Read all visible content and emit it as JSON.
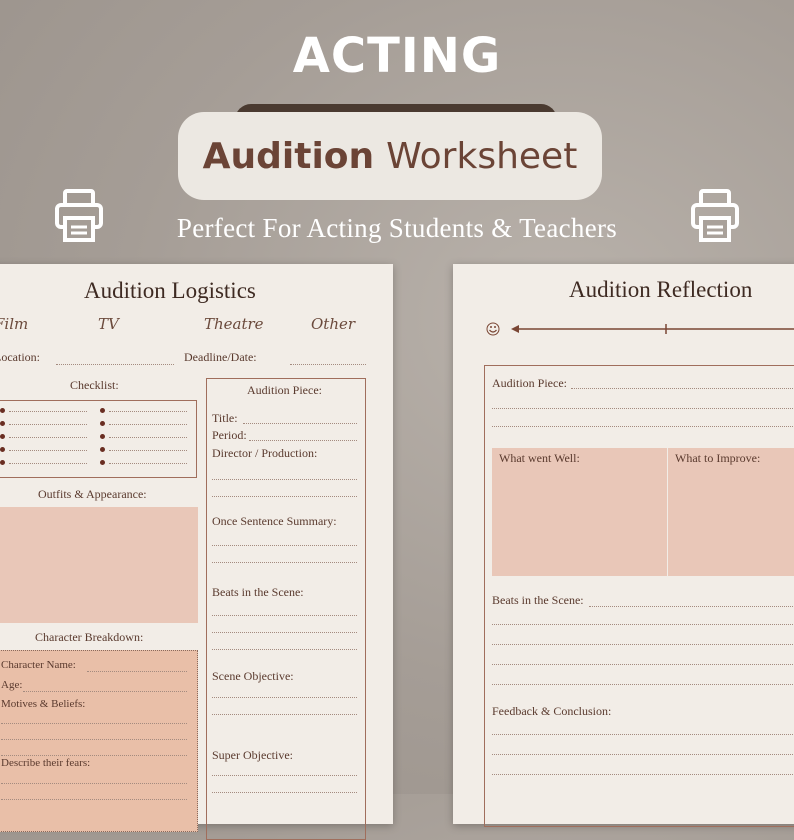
{
  "header": {
    "title": "ACTING",
    "badge_bold": "Audition",
    "badge_rest": "Worksheet",
    "subtitle": "Perfect For Acting Students & Teachers"
  },
  "colors": {
    "background": "#a59d96",
    "paper": "#f2ede7",
    "accent": "#a06e5c",
    "pink_fill": "#e9c7b8",
    "peach_fill": "#e9bfa8",
    "text": "#5a3a2e"
  },
  "icons": {
    "left_printer": "printer-icon",
    "right_printer": "printer-icon"
  },
  "logistics": {
    "title": "Audition Logistics",
    "media_types": [
      "Film",
      "TV",
      "Theatre",
      "Other"
    ],
    "location_label": "Location:",
    "deadline_label": "Deadline/Date:",
    "checklist_label": "Checklist:",
    "audition_piece": {
      "title": "Audition Piece:",
      "fields": [
        "Title:",
        "Period:",
        "Director / Production:"
      ],
      "summary": "Once Sentence Summary:",
      "beats": "Beats in the Scene:",
      "scene_objective": "Scene Objective:",
      "super_objective": "Super Objective:"
    },
    "outfits_label": "Outfits & Appearance:",
    "character": {
      "title": "Character Breakdown:",
      "name": "Character Name:",
      "age": "Age:",
      "motives": "Motives & Beliefs:",
      "fears": "Describe their fears:"
    }
  },
  "reflection": {
    "title": "Audition Reflection",
    "scale_icon": "smiley-icon",
    "audition_piece": "Audition Piece:",
    "went_well": "What went Well:",
    "improve": "What to Improve:",
    "beats": "Beats in the Scene:",
    "feedback": "Feedback & Conclusion:"
  }
}
